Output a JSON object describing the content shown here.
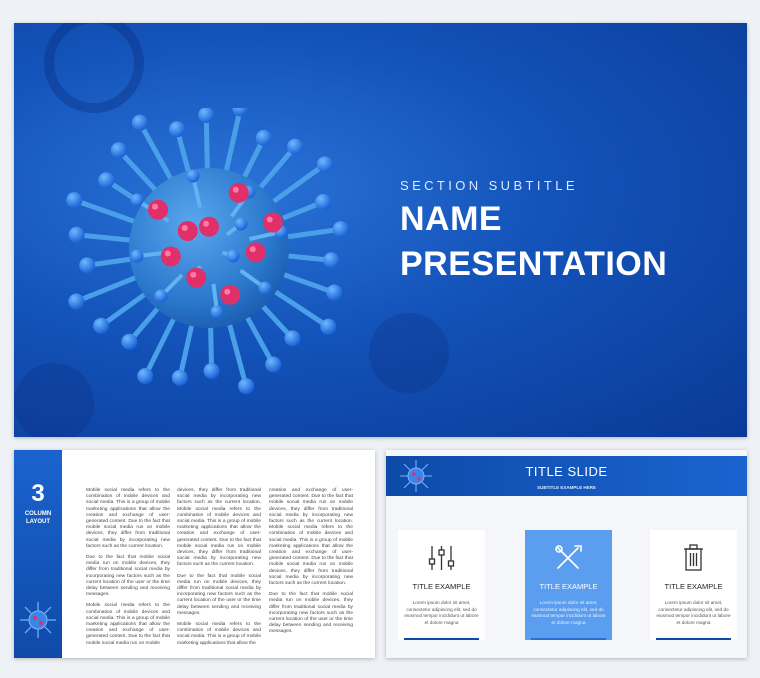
{
  "main_slide": {
    "subtitle": "SECTION SUBTITLE",
    "title_line1": "NAME",
    "title_line2": "PRESENTATION"
  },
  "column_slide": {
    "number": "3",
    "label_line1": "COLUMN",
    "label_line2": "LAYOUT",
    "columns": [
      {
        "p1": "Mobile social media refers to the combination of mobile devices and social media. This is a group of mobile marketing applications that allow the creation and exchange of user-generated content. Due to the fact that mobile social media run on mobile devices, they differ from traditional social media by incorporating new factors such as the current location.",
        "p2": "Due to the fact that mobile social media run on mobile devices, they differ from traditional social media by incorporating new factors such as the current location of the user or the time delay between sending and receiving messages.",
        "p3": "Mobile social media refers to the combination of mobile devices and social media. This is a group of mobile marketing applications that allow the creation and exchange of user-generated content. Due to the fact that mobile social media run on mobile"
      },
      {
        "p1": "devices, they differ from traditional social media by incorporating new factors such as the current location. Mobile social media refers to the combination of mobile devices and social media. This is a group of mobile marketing applications that allow the creation and exchange of user-generated content. Due to the fact that mobile social media run on mobile devices, they differ from traditional social media by incorporating new factors such as the current location.",
        "p2": "Due to the fact that mobile social media run on mobile devices, they differ from traditional social media by incorporating new factors such as the current location of the user or the time delay between sending and receiving messages.",
        "p3": "Mobile social media refers to the combination of mobile devices and social media. This is a group of mobile marketing applications that allow the"
      },
      {
        "p1": "creation and exchange of user-generated content. Due to the fact that mobile social media run on mobile devices, they differ from traditional social media by incorporating new factors such as the current location. Mobile social media refers to the combination of mobile devices and social media. This is a group of mobile marketing applications that allow the creation and exchange of user-generated content. Due to the fact that mobile social media run on mobile devices, they differ from traditional social media by incorporating new factors such as the current location.",
        "p2": "Due to the fact that mobile social media run on mobile devices, they differ from traditional social media by incorporating new factors such as the current location of the user or the time delay between sending and receiving messages."
      }
    ]
  },
  "title_slide": {
    "title": "TITLE SLIDE",
    "subtitle": "SUBTITLE EXAMPLE HERE",
    "cards": [
      {
        "icon": "sliders-icon",
        "title": "TITLE EXAMPLE",
        "text": "Lorem ipsum dolor sit amet, consectetur adipiscing elit, sed do eiusmod tempor incididunt ut labore et dolore magna",
        "highlighted": false
      },
      {
        "icon": "tools-icon",
        "title": "TITLE EXAMPLE",
        "text": "Lorem ipsum dolor sit amet, consectetur adipiscing elit, sed do eiusmod tempor incididunt ut labore et dolore magna",
        "highlighted": true
      },
      {
        "icon": "trash-icon",
        "title": "TITLE EXAMPLE",
        "text": "Lorem ipsum dolor sit amet, consectetur adipiscing elit, sed do eiusmod tempor incididunt ut labore et dolore magna",
        "highlighted": false
      }
    ]
  },
  "colors": {
    "brand_blue": "#1352b8",
    "dark_blue": "#0e4aa8",
    "highlight_card": "#5b9ef0",
    "spike_pink": "#e0306a"
  }
}
